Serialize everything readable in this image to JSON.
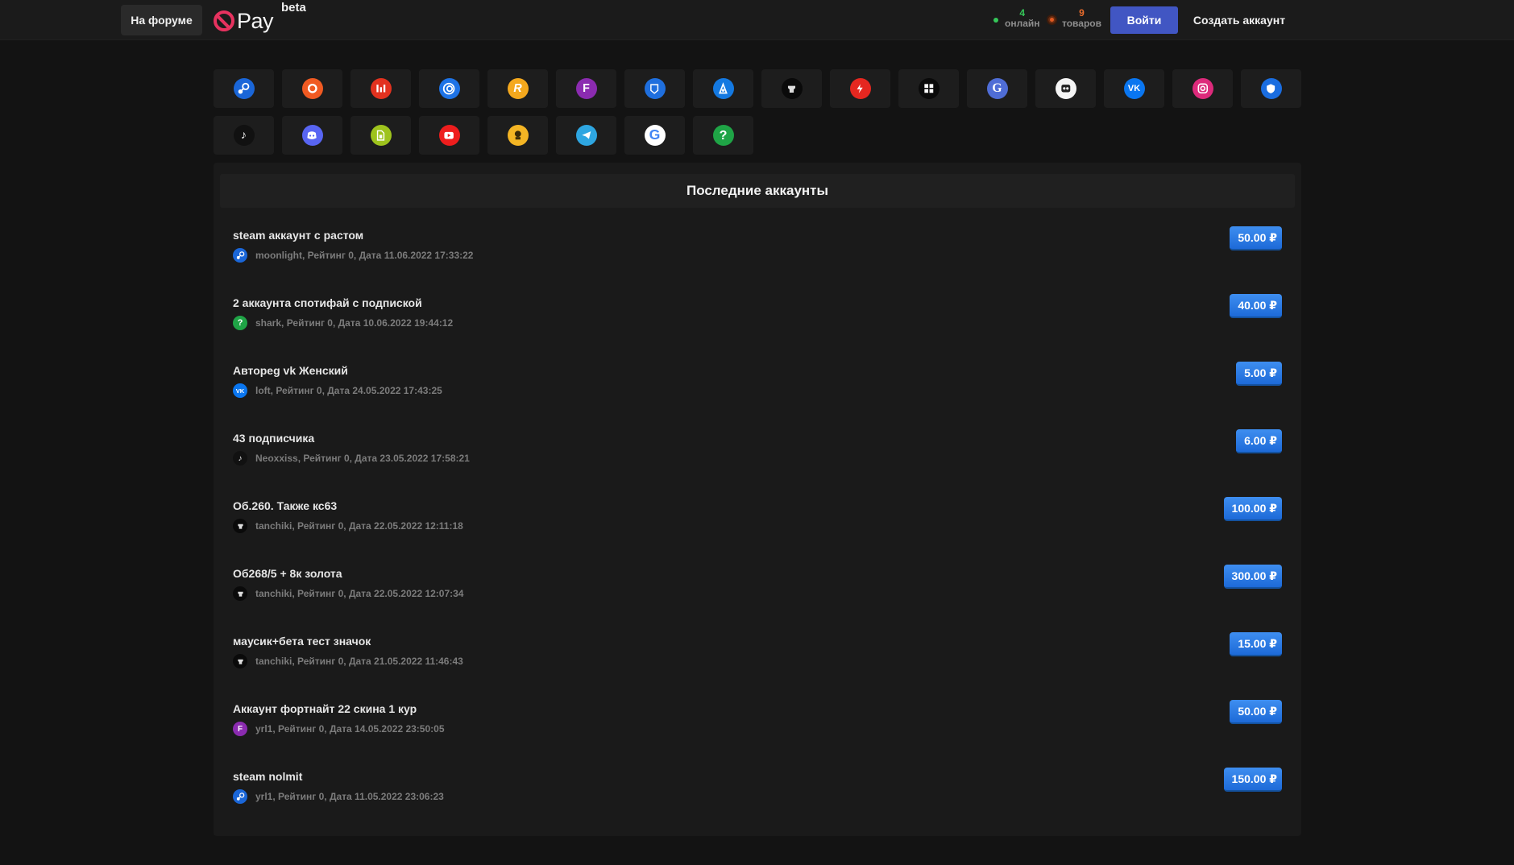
{
  "header": {
    "forum_label": "На форуме",
    "logo_text": "Pay",
    "beta_label": "beta",
    "online_count": "4",
    "online_label": "онлайн",
    "goods_count": "9",
    "goods_label": "товаров",
    "login_label": "Войти",
    "signup_label": "Создать аккаунт"
  },
  "categories": [
    {
      "name": "steam",
      "color": "#1a66d8"
    },
    {
      "name": "origin",
      "color": "#f05a22"
    },
    {
      "name": "wargaming",
      "color": "#e2321f"
    },
    {
      "name": "uplay",
      "color": "#1e73e6"
    },
    {
      "name": "rockstar",
      "color": "#f4a81d"
    },
    {
      "name": "fortnite",
      "color": "#8b2bb0"
    },
    {
      "name": "escape-from-tarkov",
      "color": "#1f6fde"
    },
    {
      "name": "battlenet",
      "color": "#1479e1"
    },
    {
      "name": "world-of-tanks",
      "color": "#0a0a0a"
    },
    {
      "name": "tanki-blitz",
      "color": "#e52720"
    },
    {
      "name": "social-club",
      "color": "#0a0a0a"
    },
    {
      "name": "genshin",
      "color": "#4f6dd6"
    },
    {
      "name": "gta-samp",
      "color": "#f5f5f5"
    },
    {
      "name": "vk",
      "color": "#0a76f0"
    },
    {
      "name": "instagram",
      "color": "#dd2a7b"
    },
    {
      "name": "vpn-shield",
      "color": "#1a6de0"
    },
    {
      "name": "tiktok",
      "color": "#111111"
    },
    {
      "name": "discord",
      "color": "#5865f2"
    },
    {
      "name": "sim-card",
      "color": "#9ec31d"
    },
    {
      "name": "youtube",
      "color": "#ee1d1d"
    },
    {
      "name": "escort",
      "color": "#f4b524"
    },
    {
      "name": "telegram",
      "color": "#2ea6e1"
    },
    {
      "name": "google",
      "color": "#ffffff"
    },
    {
      "name": "other",
      "color": "#1fa446"
    }
  ],
  "panel": {
    "title": "Последние аккаунты"
  },
  "items": [
    {
      "title": "steam аккаунт с растом",
      "meta": "moonlight, Рейтинг 0, Дата 11.06.2022 17:33:22",
      "price": "50.00 ₽",
      "icon": "steam",
      "icon_color": "#1a66d8"
    },
    {
      "title": "2 аккаунта спотифай с подпиской",
      "meta": "shark, Рейтинг 0, Дата 10.06.2022 19:44:12",
      "price": "40.00 ₽",
      "icon": "other",
      "icon_color": "#1fa446"
    },
    {
      "title": "Автореg vk Женский",
      "meta": "loft, Рейтинг 0, Дата 24.05.2022 17:43:25",
      "price": "5.00 ₽",
      "icon": "vk",
      "icon_color": "#0a76f0"
    },
    {
      "title": "43 подписчика",
      "meta": "Neoxxiss, Рейтинг 0, Дата 23.05.2022 17:58:21",
      "price": "6.00 ₽",
      "icon": "tiktok",
      "icon_color": "#111111"
    },
    {
      "title": "Об.260. Также кс63",
      "meta": "tanchiki, Рейтинг 0, Дата 22.05.2022 12:11:18",
      "price": "100.00 ₽",
      "icon": "world-of-tanks",
      "icon_color": "#0a0a0a"
    },
    {
      "title": "Об268/5 + 8к золота",
      "meta": "tanchiki, Рейтинг 0, Дата 22.05.2022 12:07:34",
      "price": "300.00 ₽",
      "icon": "world-of-tanks",
      "icon_color": "#0a0a0a"
    },
    {
      "title": "маусик+бета тест значок",
      "meta": "tanchiki, Рейтинг 0, Дата 21.05.2022 11:46:43",
      "price": "15.00 ₽",
      "icon": "world-of-tanks",
      "icon_color": "#0a0a0a"
    },
    {
      "title": "Аккаунт фортнайт 22 скина 1 кур",
      "meta": "yrl1, Рейтинг 0, Дата 14.05.2022 23:50:05",
      "price": "50.00 ₽",
      "icon": "fortnite",
      "icon_color": "#8b2bb0"
    },
    {
      "title": "steam nolmit",
      "meta": "yrl1, Рейтинг 0, Дата 11.05.2022 23:06:23",
      "price": "150.00 ₽",
      "icon": "steam",
      "icon_color": "#1a66d8"
    }
  ]
}
